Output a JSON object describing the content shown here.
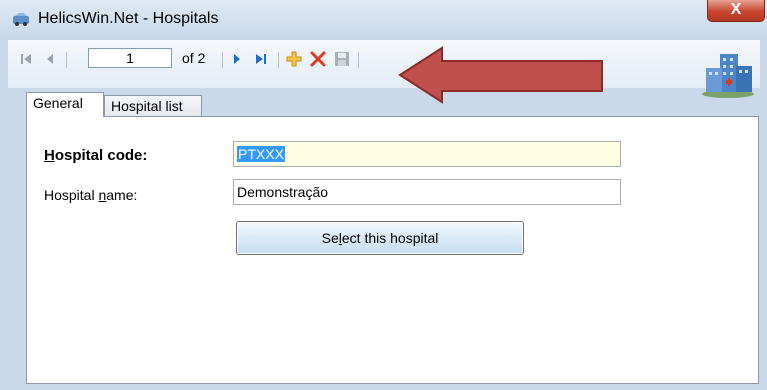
{
  "window": {
    "title": "HelicsWin.Net - Hospitals",
    "close_label": "X"
  },
  "toolbar": {
    "position_value": "1",
    "of_count": "of 2",
    "icons": [
      "first-record",
      "previous-record",
      "next-record",
      "last-record",
      "add-new",
      "delete",
      "save"
    ]
  },
  "tabs": [
    {
      "label": "General",
      "active": true
    },
    {
      "label": "Hospital list",
      "active": false
    }
  ],
  "form": {
    "hospital_code": {
      "label_prefix": "",
      "label_accel": "H",
      "label_suffix": "ospital code:",
      "value": "PTXXX"
    },
    "hospital_name": {
      "label_prefix": "Hospital ",
      "label_accel": "n",
      "label_suffix": "ame:",
      "value": "Demonstração"
    },
    "select_button": {
      "prefix": "Se",
      "accel": "l",
      "suffix": "ect this hospital"
    }
  },
  "colors": {
    "arrow": "#c0504d",
    "delete": "#e03a1e",
    "add": "#f0b030",
    "nav": "#1f6fc8",
    "selection": "#3399ff",
    "code_field_bg": "#fffde4"
  }
}
